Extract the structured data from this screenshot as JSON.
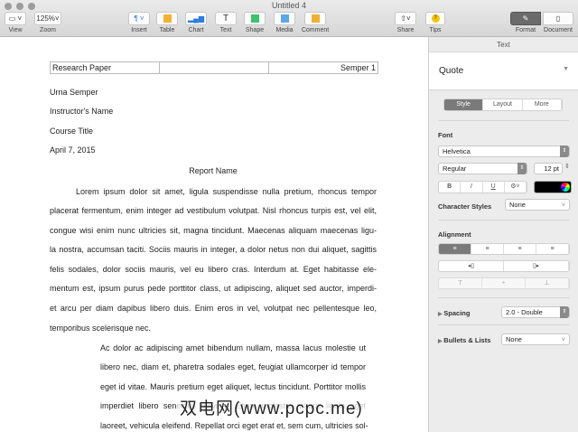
{
  "window": {
    "title": "Untitled 4"
  },
  "toolbar": {
    "view": "View",
    "zoom_value": "125%",
    "zoom": "Zoom",
    "insert": "Insert",
    "table": "Table",
    "chart": "Chart",
    "text": "Text",
    "shape": "Shape",
    "media": "Media",
    "comment": "Comment",
    "share": "Share",
    "tips": "Tips",
    "format": "Format",
    "document": "Document"
  },
  "sidebar": {
    "header": "Text",
    "paragraph_style": "Quote",
    "tabs": [
      "Style",
      "Layout",
      "More"
    ],
    "font_label": "Font",
    "font": "Helvetica",
    "typeface": "Regular",
    "size": "12 pt",
    "bold": "B",
    "italic": "I",
    "underline": "U",
    "char_styles_label": "Character Styles",
    "char_styles": "None",
    "alignment_label": "Alignment",
    "spacing_label": "Spacing",
    "spacing": "2.0 - Double",
    "bullets_label": "Bullets & Lists",
    "bullets": "None"
  },
  "document": {
    "header": [
      "Research Paper",
      "",
      "Semper 1"
    ],
    "author": "Urna Semper",
    "instructor": "Instructor's Name",
    "course": "Course Title",
    "date": "April 7, 2015",
    "report_title": "Report Name",
    "para": [
      "Lorem ipsum dolor sit amet, ligula suspendisse nulla pretium, rhoncus tempor",
      "placerat fermentum, enim integer ad vestibulum volutpat. Nisl rhoncus turpis est, vel elit,",
      "congue wisi enim nunc ultricies sit, magna tincidunt. Maecenas aliquam maecenas ligu-",
      "la nostra, accumsan taciti. Sociis mauris in integer, a dolor netus non dui aliquet, sagittis",
      "felis sodales, dolor sociis mauris, vel eu libero cras. Interdum at. Eget habitasse ele-",
      "mentum est, ipsum purus pede porttitor class, ut adipiscing, aliquet sed auctor, imperdi-",
      "et arcu per diam dapibus libero duis. Enim eros in vel, volutpat nec pellentesque leo,",
      "temporibus scelerisque nec."
    ],
    "quote": [
      "Ac dolor ac adipiscing amet bibendum nullam, massa lacus molestie ut",
      "libero nec, diam et, pharetra sodales eget, feugiat ullamcorper id tempor",
      "eget id vitae. Mauris pretium eget aliquet, lectus tincidunt. Porttitor mollis",
      "imperdiet libero senectus pulvinar. Etiam molestie mauris ligula eget",
      "laoreet, vehicula eleifend. Repellat orci eget erat et, sem cum, ultricies sol-"
    ]
  },
  "watermark": "双电网(www.pcpc.me)"
}
